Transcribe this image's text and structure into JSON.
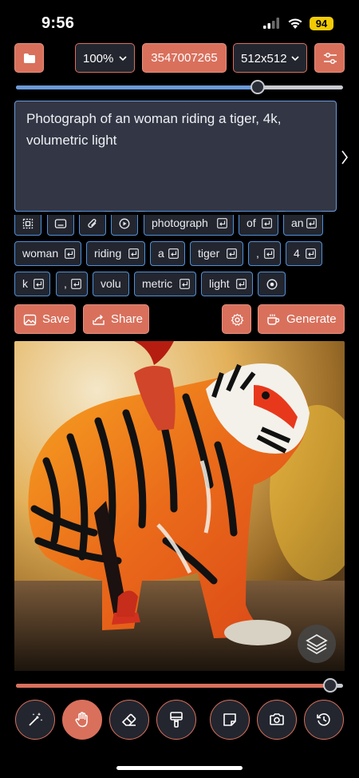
{
  "status_bar": {
    "time": "9:56",
    "battery": "94",
    "battery_color": "#f2cb05"
  },
  "toolbar": {
    "folder_icon": "folder-icon",
    "zoom": "100%",
    "seed": "3547007265",
    "size": "512x512",
    "settings_icon": "sliders-icon"
  },
  "slider_top": {
    "value_fraction": 0.74
  },
  "prompt": {
    "text": "Photograph of an woman riding a tiger, 4k, volumetric light"
  },
  "tokens": {
    "row1": [
      "photograph",
      "of",
      "an"
    ],
    "row2": [
      "woman",
      "riding",
      "a",
      "tiger",
      ",",
      "4"
    ],
    "row3": [
      "k",
      ",",
      "volu",
      "metric",
      "light"
    ]
  },
  "actions": {
    "save_label": "Save",
    "share_label": "Share",
    "generate_label": "Generate"
  },
  "slider_bottom": {
    "value_fraction": 0.96
  },
  "bottom_tools": [
    "magic-wand-icon",
    "hand-icon",
    "eraser-icon",
    "paint-roller-icon",
    "sticky-note-icon",
    "camera-icon",
    "history-icon"
  ],
  "colors": {
    "accent": "#d9705c",
    "panel": "#23262f",
    "token_border": "#4f8fd8",
    "prompt_bg": "#333745"
  }
}
